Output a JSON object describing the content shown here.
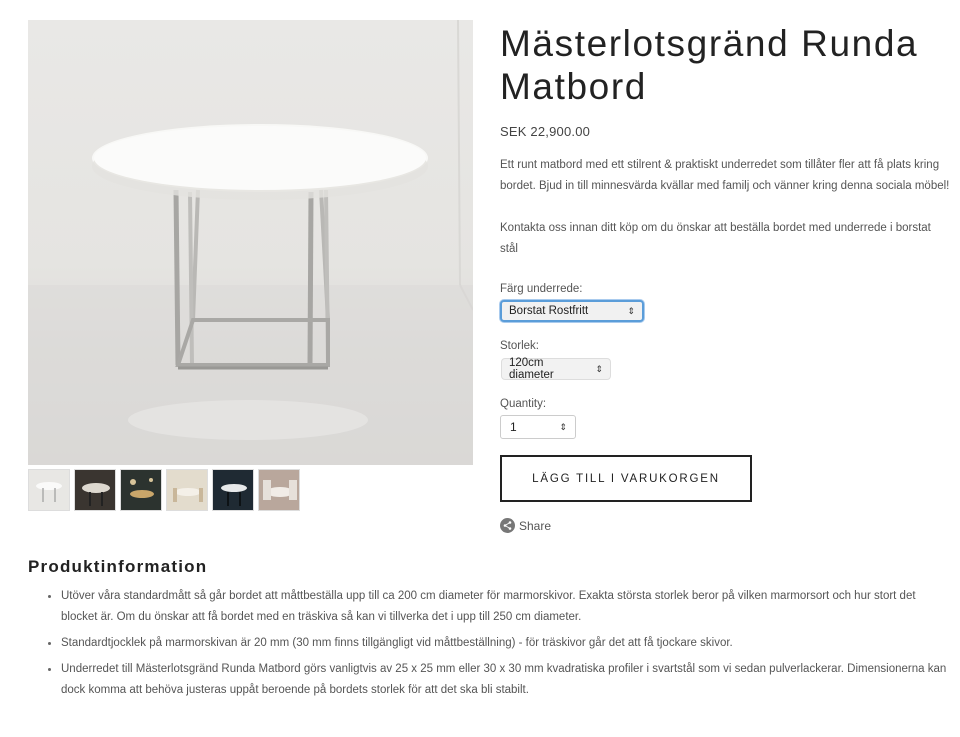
{
  "product": {
    "title": "Mästerlotsgränd Runda Matbord",
    "price": "SEK 22,900.00",
    "description": [
      "Ett runt matbord med ett stilrent & praktiskt underredet som tillåter fler att få plats kring bordet. Bjud in till minnesvärda kvällar med familj och vänner kring denna sociala möbel!",
      "Kontakta oss innan ditt köp om du önskar att beställa bordet med underrede i borstat stål"
    ]
  },
  "options": {
    "color": {
      "label": "Färg underrede:",
      "value": "Borstat Rostfritt"
    },
    "size": {
      "label": "Storlek:",
      "value": "120cm diameter"
    },
    "quantity": {
      "label": "Quantity:",
      "value": "1"
    }
  },
  "actions": {
    "add_to_cart": "LÄGG TILL I VARUKORGEN",
    "share": "Share"
  },
  "gallery": {
    "thumbnails": [
      "thumb-1",
      "thumb-2",
      "thumb-3",
      "thumb-4",
      "thumb-5",
      "thumb-6"
    ]
  },
  "info": {
    "heading": "Produktinformation",
    "items": [
      "Utöver våra standardmått så går bordet att måttbeställa upp till ca 200 cm diameter för marmorskivor. Exakta största storlek beror på vilken marmorsort och hur stort det blocket är. Om du önskar att få bordet med en träskiva så kan vi tillverka det i upp till 250 cm diameter.",
      "Standardtjocklek på marmorskivan är 20 mm (30 mm finns tillgängligt vid måttbeställning) - för träskivor går det att få tjockare skivor.",
      "Underredet till Mästerlotsgränd Runda Matbord görs vanligtvis av 25 x 25 mm eller 30 x 30 mm kvadratiska profiler i svartstål som vi sedan pulverlackerar. Dimensionerna kan dock komma att behöva justeras uppåt beroende på bordets storlek för att det ska bli stabilt."
    ]
  }
}
